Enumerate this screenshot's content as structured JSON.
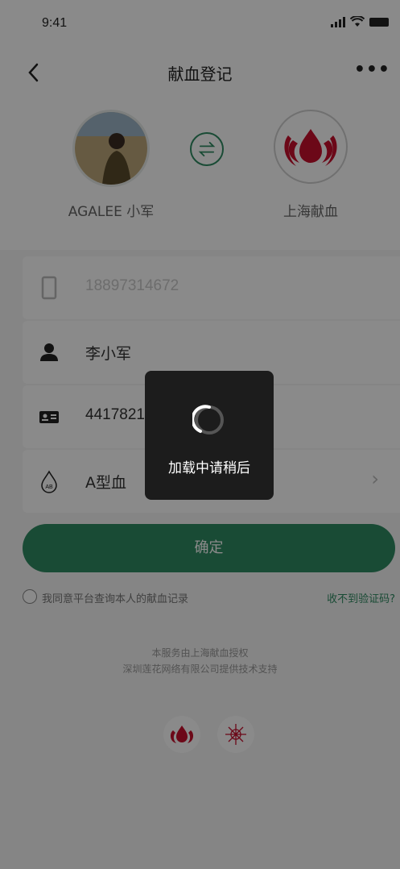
{
  "status_bar": {
    "time": "9:41"
  },
  "nav": {
    "back_icon": "chevron-left-icon",
    "title": "献血登记",
    "more_icon": "more-dots-icon"
  },
  "profile": {
    "user_name": "AGALEE 小军",
    "org_name": "上海献血",
    "swap_icon": "swap-arrows-icon"
  },
  "form": {
    "phone": {
      "icon": "phone-icon",
      "placeholder": "18897314672"
    },
    "name": {
      "icon": "person-icon",
      "value": "李小军"
    },
    "id_card": {
      "icon": "id-card-icon",
      "value": "441782199802177413"
    },
    "blood_type": {
      "icon": "blood-drop-icon",
      "value": "A型血",
      "chevron_icon": "chevron-right-icon"
    }
  },
  "confirm_label": "确定",
  "agreement": {
    "text": "我同意平台查询本人的献血记录",
    "no_code_link": "收不到验证码?"
  },
  "footer": {
    "line1": "本服务由上海献血授权",
    "line2": "深圳莲花网络有限公司提供技术支持"
  },
  "loading": {
    "text": "加载中请稍后",
    "icon": "spinner-icon"
  },
  "colors": {
    "accent": "#2f8b62",
    "brand_red": "#c8102e",
    "overlay": "rgba(0,0,0,0.46)"
  }
}
